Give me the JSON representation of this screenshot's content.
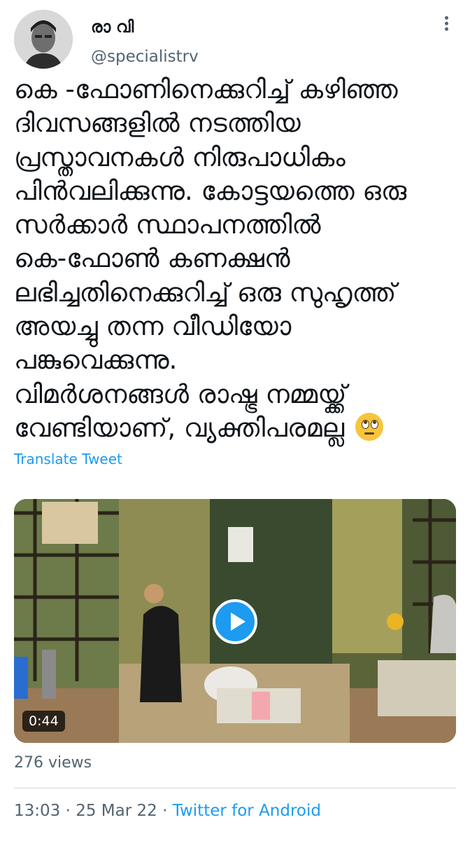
{
  "author": {
    "display_name": "രാ വി",
    "handle": "@specialistrv"
  },
  "tweet": {
    "lines": [
      "കെ -ഫോണിനെക്കുറിച്ച് കഴിഞ്ഞ",
      "ദിവസങ്ങളിൽ നടത്തിയ",
      "പ്രസ്താവനകൾ നിരുപാധികം",
      "പിൻവലിക്കുന്നു. കോട്ടയത്തെ ഒരു",
      "സർക്കാർ സ്ഥാപനത്തിൽ",
      "കെ-ഫോൺ കണക്ഷൻ",
      "ലഭിച്ചതിനെക്കുറിച്ച് ഒരു സുഹൃത്ത്",
      "അയച്ചു തന്ന വീഡിയോ",
      "പങ്കുവെക്കുന്നു.",
      "വിമർശനങ്ങൾ രാഷ്ട്ര നമ്മയ്ക്ക്",
      "വേണ്ടിയാണ്, വ്യക്തിപരമല്ല"
    ],
    "emoji": "face-with-rolling-eyes",
    "translate_label": "Translate Tweet"
  },
  "media": {
    "duration": "0:44",
    "play_icon": "play-icon"
  },
  "stats": {
    "views": "276 views"
  },
  "meta": {
    "time": "13:03",
    "separator1": " · ",
    "date": "25 Mar 22",
    "separator2": " · ",
    "source": "Twitter for Android"
  },
  "colors": {
    "link": "#1d9bf0",
    "secondary_text": "#536471",
    "primary_text": "#0f1419"
  }
}
